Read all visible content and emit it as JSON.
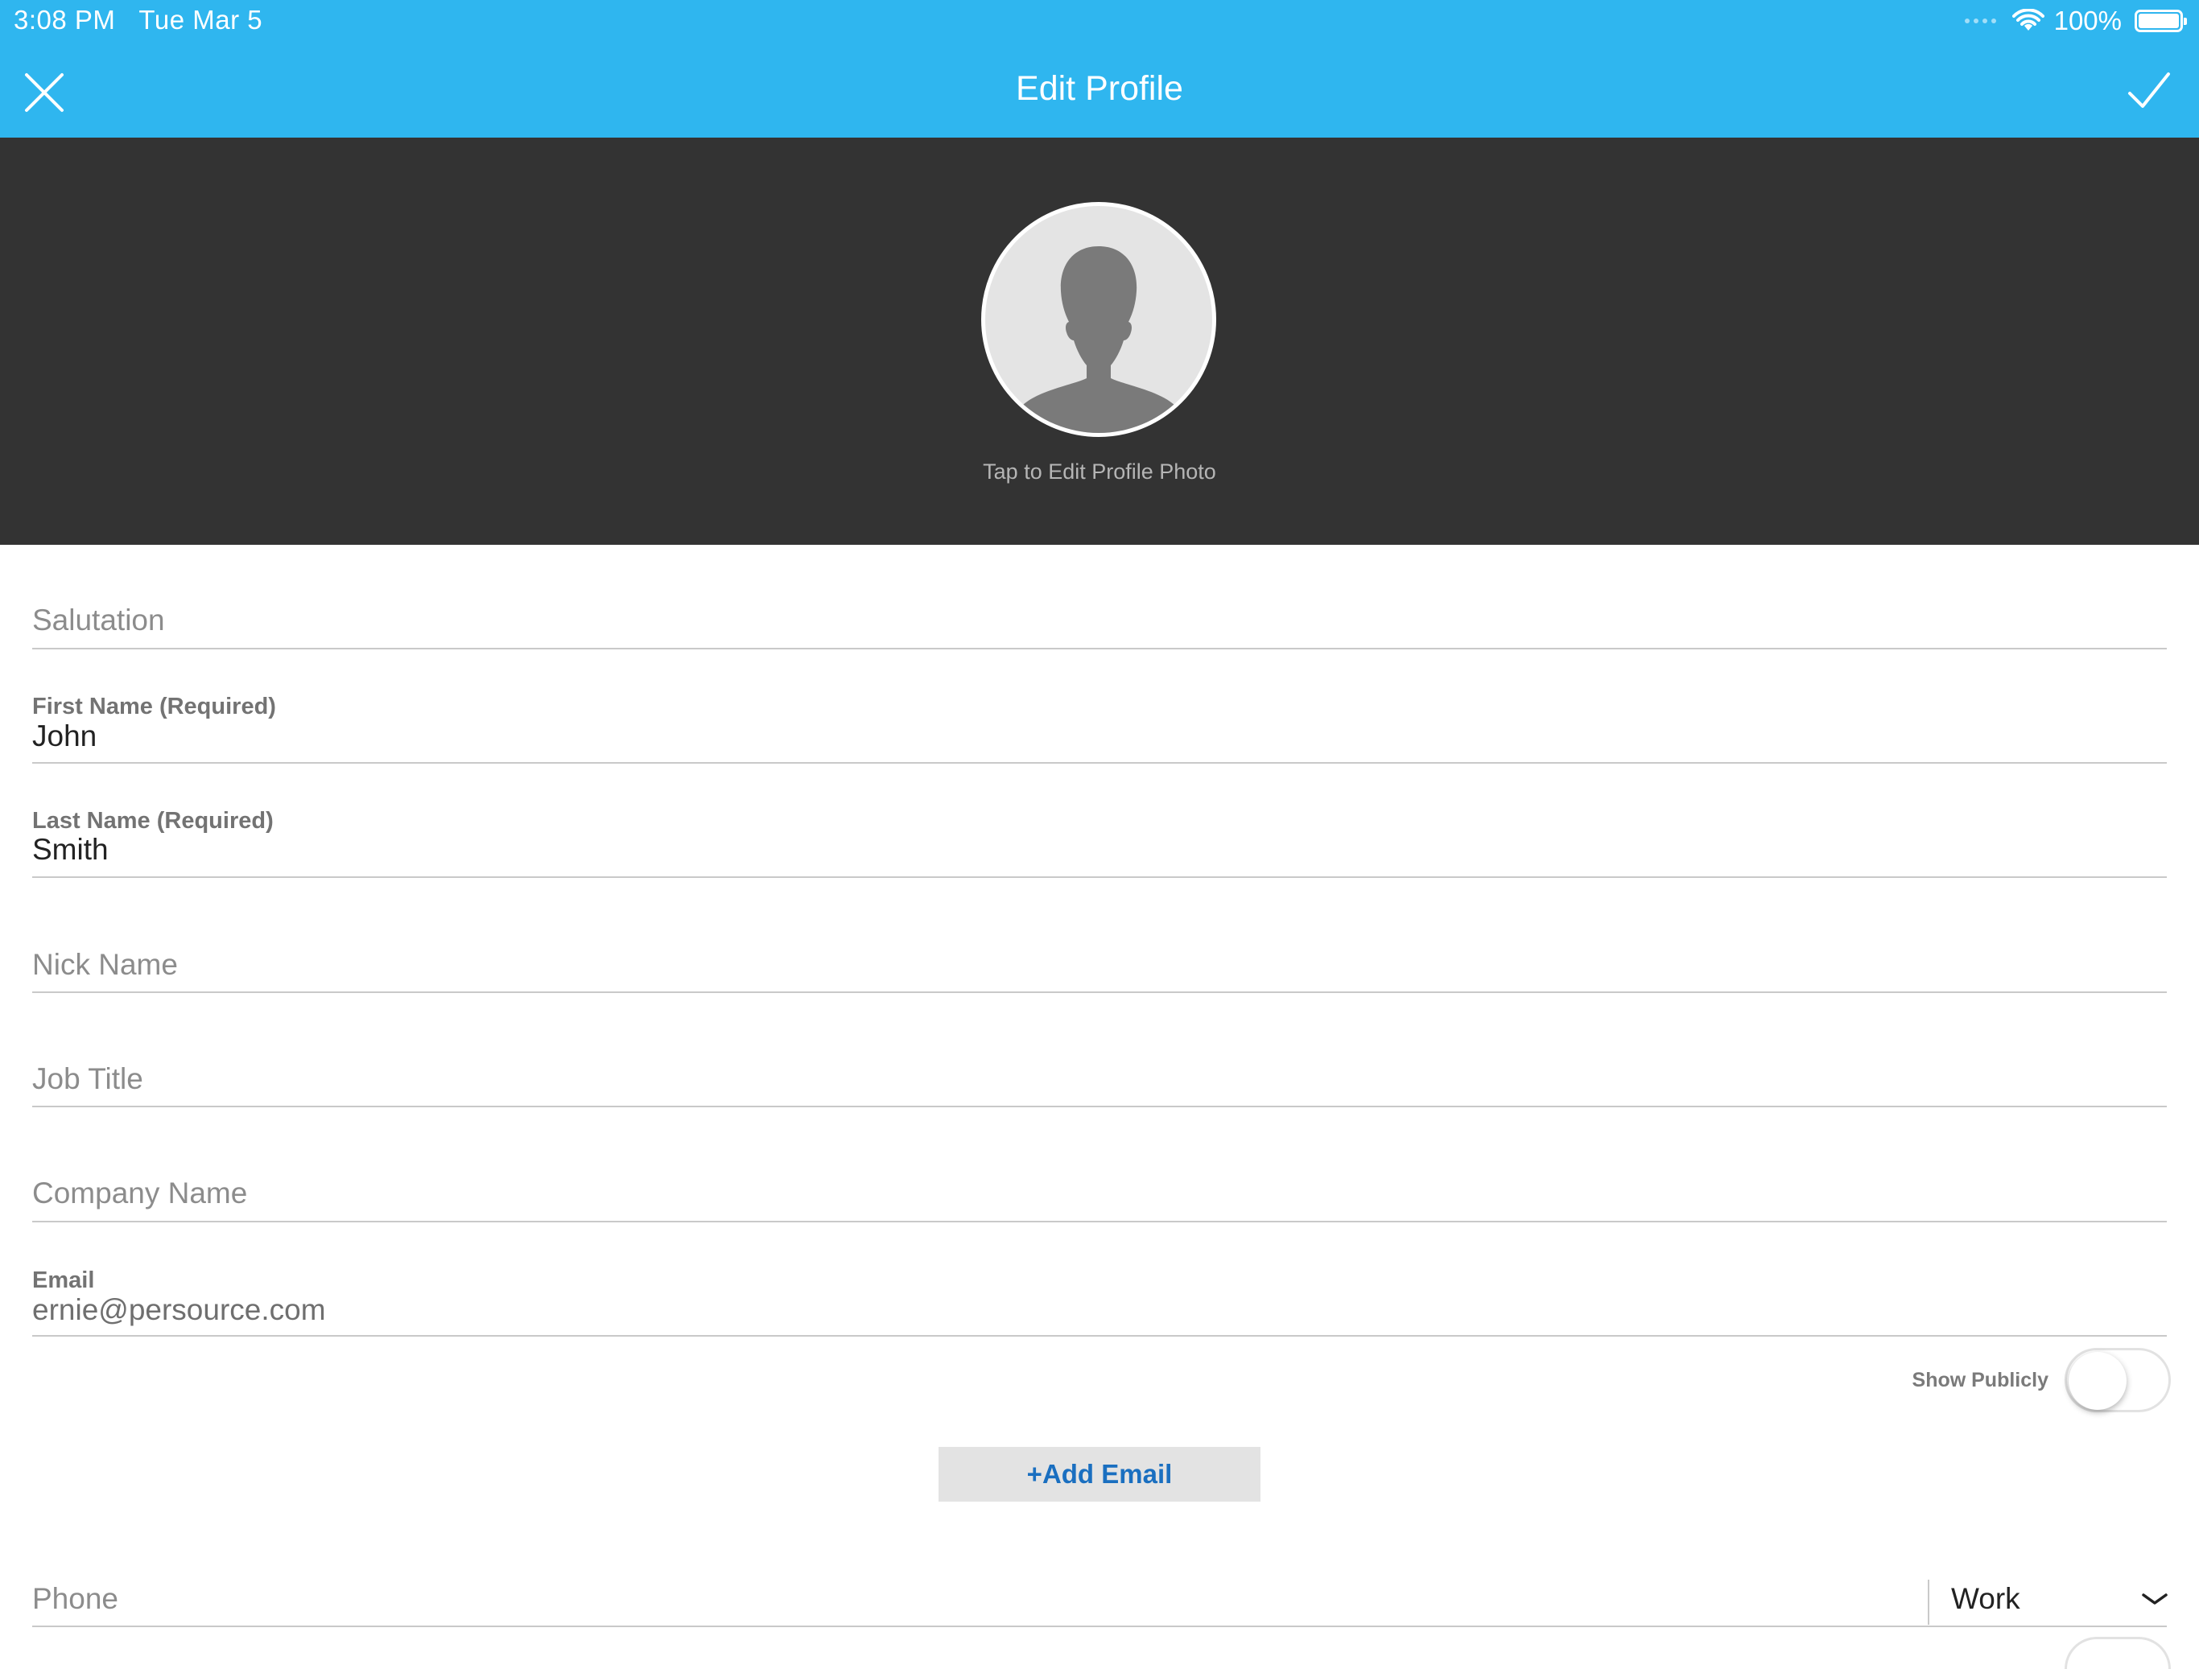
{
  "status_bar": {
    "time": "3:08 PM",
    "date": "Tue Mar 5",
    "battery": "100%",
    "icons": [
      "signal-dots-icon",
      "wifi-icon",
      "battery-icon"
    ]
  },
  "header": {
    "title": "Edit Profile",
    "close_icon": "close-icon",
    "done_icon": "checkmark-icon",
    "background": "#2fb6ef"
  },
  "photo": {
    "hint": "Tap to Edit Profile Photo",
    "icon": "person-silhouette-icon"
  },
  "form": {
    "salutation": {
      "placeholder": "Salutation"
    },
    "first_name": {
      "label": "First Name (Required)",
      "value": "John"
    },
    "last_name": {
      "label": "Last Name (Required)",
      "value": "Smith"
    },
    "nick_name": {
      "placeholder": "Nick Name"
    },
    "job_title": {
      "placeholder": "Job Title"
    },
    "company_name": {
      "placeholder": "Company Name"
    },
    "email": {
      "label": "Email",
      "value": "ernie@persource.com"
    },
    "show_publicly": {
      "label": "Show Publicly",
      "on": false
    },
    "add_email": {
      "label": "+Add Email",
      "color": "#1a6fc0"
    },
    "phone": {
      "placeholder": "Phone",
      "type_selected": "Work"
    }
  }
}
